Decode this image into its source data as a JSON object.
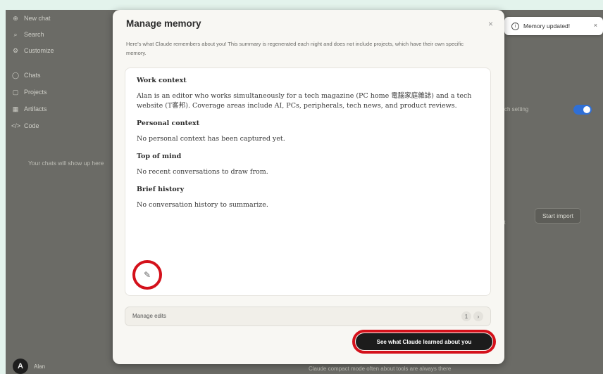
{
  "sidebar": {
    "items": [
      {
        "icon": "plus-icon",
        "glyph": "⊕",
        "label": "New chat"
      },
      {
        "icon": "search-icon",
        "glyph": "⌕",
        "label": "Search"
      },
      {
        "icon": "customize-icon",
        "glyph": "⚙",
        "label": "Customize"
      },
      {
        "icon": "chats-icon",
        "glyph": "◯",
        "label": "Chats"
      },
      {
        "icon": "projects-icon",
        "glyph": "▢",
        "label": "Projects"
      },
      {
        "icon": "artifacts-icon",
        "glyph": "▦",
        "label": "Artifacts"
      },
      {
        "icon": "code-icon",
        "glyph": "</>",
        "label": "Code"
      }
    ],
    "empty_text": "Your chats will show up here",
    "user_initial": "A",
    "user_name": "Alan"
  },
  "background": {
    "setting_text": "ch setting",
    "start_import_label": "Start import",
    "fragment_text": "ut",
    "bottom_text": "Claude compact mode often about tools are always there"
  },
  "toast": {
    "text": "Memory updated!",
    "close": "×"
  },
  "modal": {
    "title": "Manage memory",
    "close": "×",
    "description": "Here's what Claude remembers about you! This summary is regenerated each night and does not include projects, which have their own specific memory.",
    "sections": [
      {
        "heading": "Work context",
        "body": "Alan is an editor who works simultaneously for a tech magazine (PC home 電腦家庭雜誌) and a tech website (T客邦). Coverage areas include AI, PCs, peripherals, tech news, and product reviews."
      },
      {
        "heading": "Personal context",
        "body": "No personal context has been captured yet."
      },
      {
        "heading": "Top of mind",
        "body": "No recent conversations to draw from."
      },
      {
        "heading": "Brief history",
        "body": "No conversation history to summarize."
      }
    ],
    "manage_edits_label": "Manage edits",
    "manage_edits_count": "1",
    "manage_edits_arrow": "›",
    "learn_button_label": "See what Claude learned about you",
    "highlight_color": "#d4111b"
  }
}
